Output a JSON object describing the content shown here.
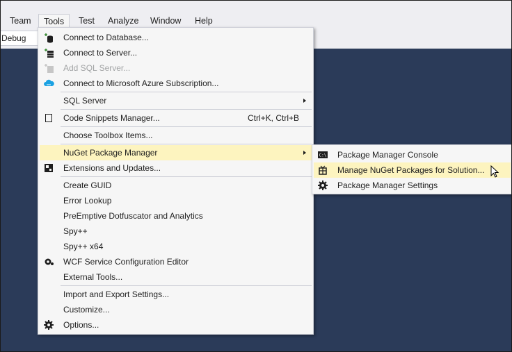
{
  "menubar": {
    "items": [
      {
        "label": "Team"
      },
      {
        "label": "Tools"
      },
      {
        "label": "Test"
      },
      {
        "label": "Analyze"
      },
      {
        "label": "Window"
      },
      {
        "label": "Help"
      }
    ]
  },
  "toolbar": {
    "config_value": "Debug"
  },
  "tools_menu": {
    "items": [
      {
        "label": "Connect to Database...",
        "icon": "database-connect-icon"
      },
      {
        "label": "Connect to Server...",
        "icon": "server-connect-icon"
      },
      {
        "label": "Add SQL Server...",
        "icon": "add-sql-server-icon",
        "disabled": true
      },
      {
        "label": "Connect to Microsoft Azure Subscription...",
        "icon": "azure-cloud-icon"
      },
      {
        "label": "SQL Server",
        "submenu": true
      },
      {
        "label": "Code Snippets Manager...",
        "shortcut": "Ctrl+K, Ctrl+B",
        "icon": "snippet-icon"
      },
      {
        "label": "Choose Toolbox Items..."
      },
      {
        "label": "NuGet Package Manager",
        "submenu": true,
        "highlighted": true
      },
      {
        "label": "Extensions and Updates...",
        "icon": "extensions-icon"
      },
      {
        "label": "Create GUID"
      },
      {
        "label": "Error Lookup"
      },
      {
        "label": "PreEmptive Dotfuscator and Analytics"
      },
      {
        "label": "Spy++"
      },
      {
        "label": "Spy++ x64"
      },
      {
        "label": "WCF Service Configuration Editor",
        "icon": "wcf-gear-icon"
      },
      {
        "label": "External Tools..."
      },
      {
        "label": "Import and Export Settings..."
      },
      {
        "label": "Customize..."
      },
      {
        "label": "Options...",
        "icon": "options-gear-icon"
      }
    ]
  },
  "nuget_submenu": {
    "items": [
      {
        "label": "Package Manager Console",
        "icon": "console-icon"
      },
      {
        "label": "Manage NuGet Packages for Solution...",
        "icon": "package-icon",
        "highlighted": true
      },
      {
        "label": "Package Manager Settings",
        "icon": "settings-gear-icon"
      }
    ]
  },
  "colors": {
    "menu_bg": "#f6f6f6",
    "highlight": "#fdf4bf",
    "editor_bg": "#2b3b59",
    "menubar_bg": "#eeeef2"
  }
}
